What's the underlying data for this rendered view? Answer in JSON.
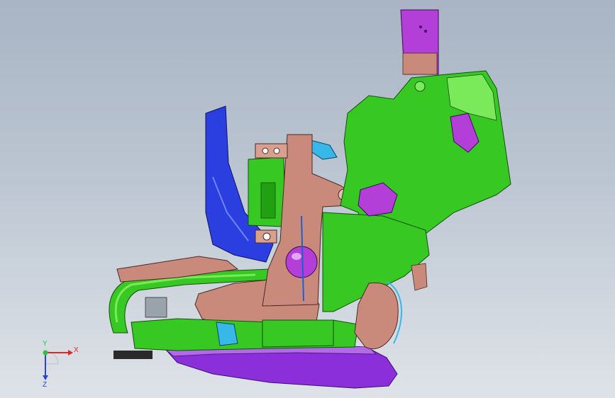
{
  "viewport": {
    "background_top": "#a9b4c4",
    "background_bottom": "#dfe3e8"
  },
  "model": {
    "part_colors": {
      "green": "#37c824",
      "light_green": "#7bea5a",
      "salmon": "#c98a7c",
      "magenta": "#b33ed8",
      "blue": "#2b3fe0",
      "purple_base": "#8a2fd9",
      "cyan": "#38b8e8"
    }
  },
  "triad": {
    "x_label": "X",
    "y_label": "Y",
    "z_label": "Z",
    "x_color": "#e0262b",
    "y_color": "#2fc23a",
    "z_color": "#2b43d6"
  }
}
